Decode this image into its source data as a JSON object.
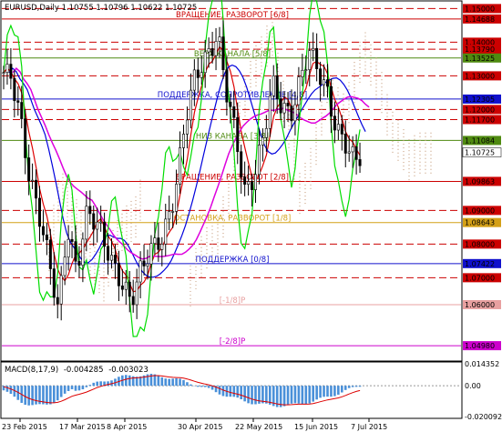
{
  "window": {
    "title": "EURUSD,Daily  1.10755 1.10796 1.10622 1.10725"
  },
  "chart_data": {
    "type": "candlestick",
    "symbol": "EURUSD",
    "timeframe": "Daily",
    "ohlc": {
      "open": "1.10755",
      "high": "1.10796",
      "low": "1.10622",
      "close": "1.10725"
    },
    "ylim": [
      1.0455,
      1.152
    ],
    "x_ticks": [
      "23 Feb 2015",
      "17 Mar 2015",
      "8 Apr 2015",
      "30 Apr 2015",
      "22 May 2015",
      "15 Jun 2015",
      "7 Jul 2015"
    ],
    "y_ticks": [
      "1.14780",
      "1.14050",
      "1.13310",
      "1.12580",
      "1.11840",
      "1.11110",
      "1.10375",
      "1.09640",
      "1.08905",
      "1.08170",
      "1.07435",
      "1.06700",
      "1.05970",
      "1.05240",
      "1.04500"
    ],
    "levels": [
      {
        "price": 1.15,
        "label": "1.15000",
        "name": "",
        "color": "#cc0000",
        "style": "dash"
      },
      {
        "price": 1.1469,
        "label": "1.14688",
        "name": "ВРАЩЕНИЕ, РАЗВОРОТ [6/8]",
        "color": "#cc0000",
        "style": "solid"
      },
      {
        "price": 1.14,
        "label": "1.14000",
        "name": "",
        "color": "#cc0000",
        "style": "dash"
      },
      {
        "price": 1.1379,
        "label": "1.13790",
        "name": "",
        "color": "#cc0000",
        "style": "dash"
      },
      {
        "price": 1.1353,
        "label": "1.13525",
        "name": "ВЕРХ КАНАЛА [5/8]",
        "color": "#4f8a10",
        "style": "solid"
      },
      {
        "price": 1.13,
        "label": "1.13000",
        "name": "",
        "color": "#cc0000",
        "style": "dash"
      },
      {
        "price": 1.12,
        "label": "1.12000",
        "name": "",
        "color": "#cc0000",
        "style": "dash"
      },
      {
        "price": 1.1231,
        "label": "1.12305",
        "name": "ПОДДЕРЖКА, СОПРОТИВЛЕНИЕ [4/8]",
        "color": "#1010cc",
        "style": "solid"
      },
      {
        "price": 1.117,
        "label": "1.11700",
        "name": "",
        "color": "#cc0000",
        "style": "dash"
      },
      {
        "price": 1.1108,
        "label": "1.11084",
        "name": "НИЗ КАНАЛА [3/8]",
        "color": "#4f8a10",
        "style": "solid"
      },
      {
        "price": 1.09863,
        "label": "1.09863",
        "name": "ВРАЩЕНИЕ, РАЗВОРОТ [2/8]",
        "color": "#cc0000",
        "style": "solid"
      },
      {
        "price": 1.09,
        "label": "1.09000",
        "name": "",
        "color": "#cc0000",
        "style": "dash"
      },
      {
        "price": 1.0864,
        "label": "1.08643",
        "name": "ОСТАНОВКА, РАЗВОРОТ [1/8]",
        "color": "#d4a017",
        "style": "solid"
      },
      {
        "price": 1.08,
        "label": "1.08000",
        "name": "",
        "color": "#cc0000",
        "style": "dash"
      },
      {
        "price": 1.0742,
        "label": "1.07422",
        "name": "ПОДДЕРЖКА [0/8]",
        "color": "#1010cc",
        "style": "solid"
      },
      {
        "price": 1.07,
        "label": "1.07000",
        "name": "",
        "color": "#cc0000",
        "style": "dash"
      },
      {
        "price": 1.062,
        "label": "1.06000",
        "name": "[-1/8]P",
        "color": "#e8a0a0",
        "style": "solid"
      },
      {
        "price": 1.0498,
        "label": "1.04980",
        "name": "[-2/8]P",
        "color": "#cc00cc",
        "style": "solid"
      }
    ],
    "current_price": {
      "label": "1.10725",
      "price": 1.10725
    },
    "macd": {
      "title": "MACD(8,17,9)",
      "value1": "-0.004285",
      "value2": "-0.003023",
      "y_ticks": [
        "0.014352",
        "0.00",
        "-0.020092"
      ],
      "ylim": [
        -0.020092,
        0.014352
      ]
    }
  },
  "colors": {
    "candle": "#000000",
    "ma_red": "#dd0000",
    "ma_blue": "#0000dd",
    "ma_magenta": "#dd00dd",
    "lime": "#00dd00",
    "cloud": "#c8a080"
  }
}
